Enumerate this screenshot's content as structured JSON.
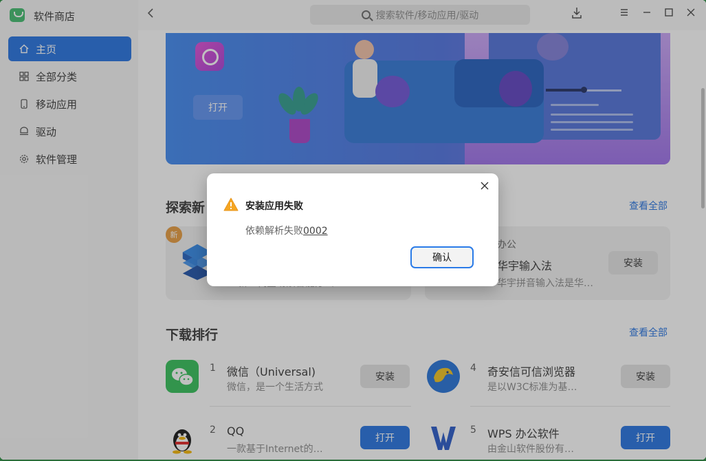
{
  "app": {
    "title": "软件商店"
  },
  "sidebar": {
    "items": [
      {
        "label": "主页",
        "icon": "home-icon",
        "active": true
      },
      {
        "label": "全部分类",
        "icon": "grid-icon",
        "active": false
      },
      {
        "label": "移动应用",
        "icon": "phone-icon",
        "active": false
      },
      {
        "label": "驱动",
        "icon": "driver-icon",
        "active": false
      },
      {
        "label": "软件管理",
        "icon": "gear-icon",
        "active": false
      }
    ]
  },
  "titlebar": {
    "search_placeholder": "搜索软件/移动应用/驱动"
  },
  "banner": {
    "open_label": "打开"
  },
  "explore": {
    "title_partial": "探索新",
    "see_all": "查看全部",
    "badge": "新",
    "left_card_desc_partial": "新一代全场景智能办公",
    "right_card": {
      "category": "办公",
      "name": "华宇输入法",
      "desc": "华宇拼音输入法是华…",
      "button": "安装"
    }
  },
  "ranking": {
    "title": "下载排行",
    "see_all": "查看全部",
    "items": [
      {
        "rank": "1",
        "name": "微信（Universal)",
        "desc": "微信，是一个生活方式",
        "button": "安装",
        "type": "install"
      },
      {
        "rank": "2",
        "name": "QQ",
        "desc": "一款基于Internet的…",
        "button": "打开",
        "type": "open"
      },
      {
        "rank": "4",
        "name": "奇安信可信浏览器",
        "desc": "是以W3C标准为基…",
        "button": "安装",
        "type": "install"
      },
      {
        "rank": "5",
        "name": "WPS 办公软件",
        "desc": "由金山软件股份有…",
        "button": "打开",
        "type": "open"
      }
    ]
  },
  "dialog": {
    "title": "安装应用失败",
    "message_prefix": "依赖解析失败",
    "error_code": "0002",
    "confirm_label": "确认"
  },
  "colors": {
    "accent": "#1f6fe0",
    "warning": "#f5a623",
    "focus_border": "#2a7be8"
  }
}
